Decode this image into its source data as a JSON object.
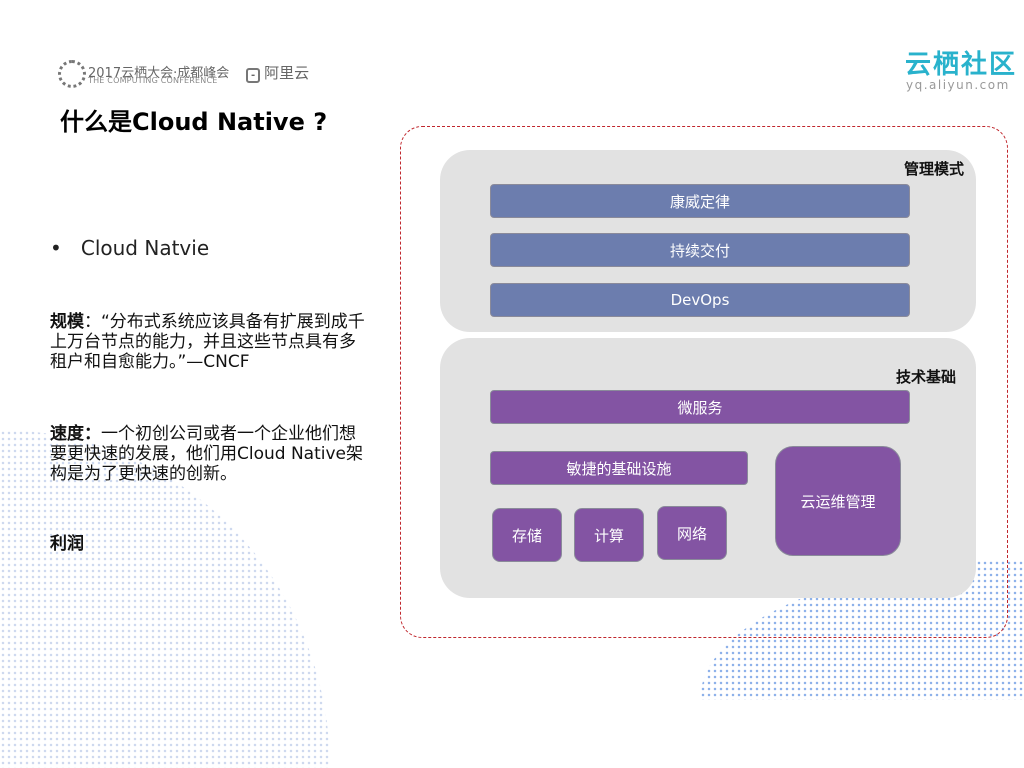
{
  "header": {
    "conference_line1": "2017云栖大会·成都峰会",
    "conference_line2": "THE COMPUTING CONFERENCE",
    "aliyun_logo": "阿里云",
    "community_logo": "云栖社区",
    "community_url": "yq.aliyun.com"
  },
  "title": "什么是Cloud Native ?",
  "bullet": "Cloud Natvie",
  "paragraphs": [
    {
      "label": "规模",
      "text": "：“分布式系统应该具备有扩展到成千上万台节点的能力，并且这些节点具有多租户和自愈能力。”—CNCF"
    },
    {
      "label": "速度：",
      "text": "一个初创公司或者一个企业他们想要更快速的发展，他们用Cloud Native架构是为了更快速的创新。"
    },
    {
      "label": "利润",
      "text": ""
    }
  ],
  "diagram": {
    "management": {
      "label": "管理模式",
      "items": [
        "康威定律",
        "持续交付",
        "DevOps"
      ]
    },
    "tech": {
      "label": "技术基础",
      "microservices": "微服务",
      "infra": "敏捷的基础设施",
      "infra_items": [
        "存储",
        "计算",
        "网络"
      ],
      "ops": "云运维管理"
    }
  },
  "colors": {
    "blue": "#6c7dae",
    "purple": "#8354a3",
    "dash": "#c0272d",
    "brand": "#29b2cc"
  }
}
